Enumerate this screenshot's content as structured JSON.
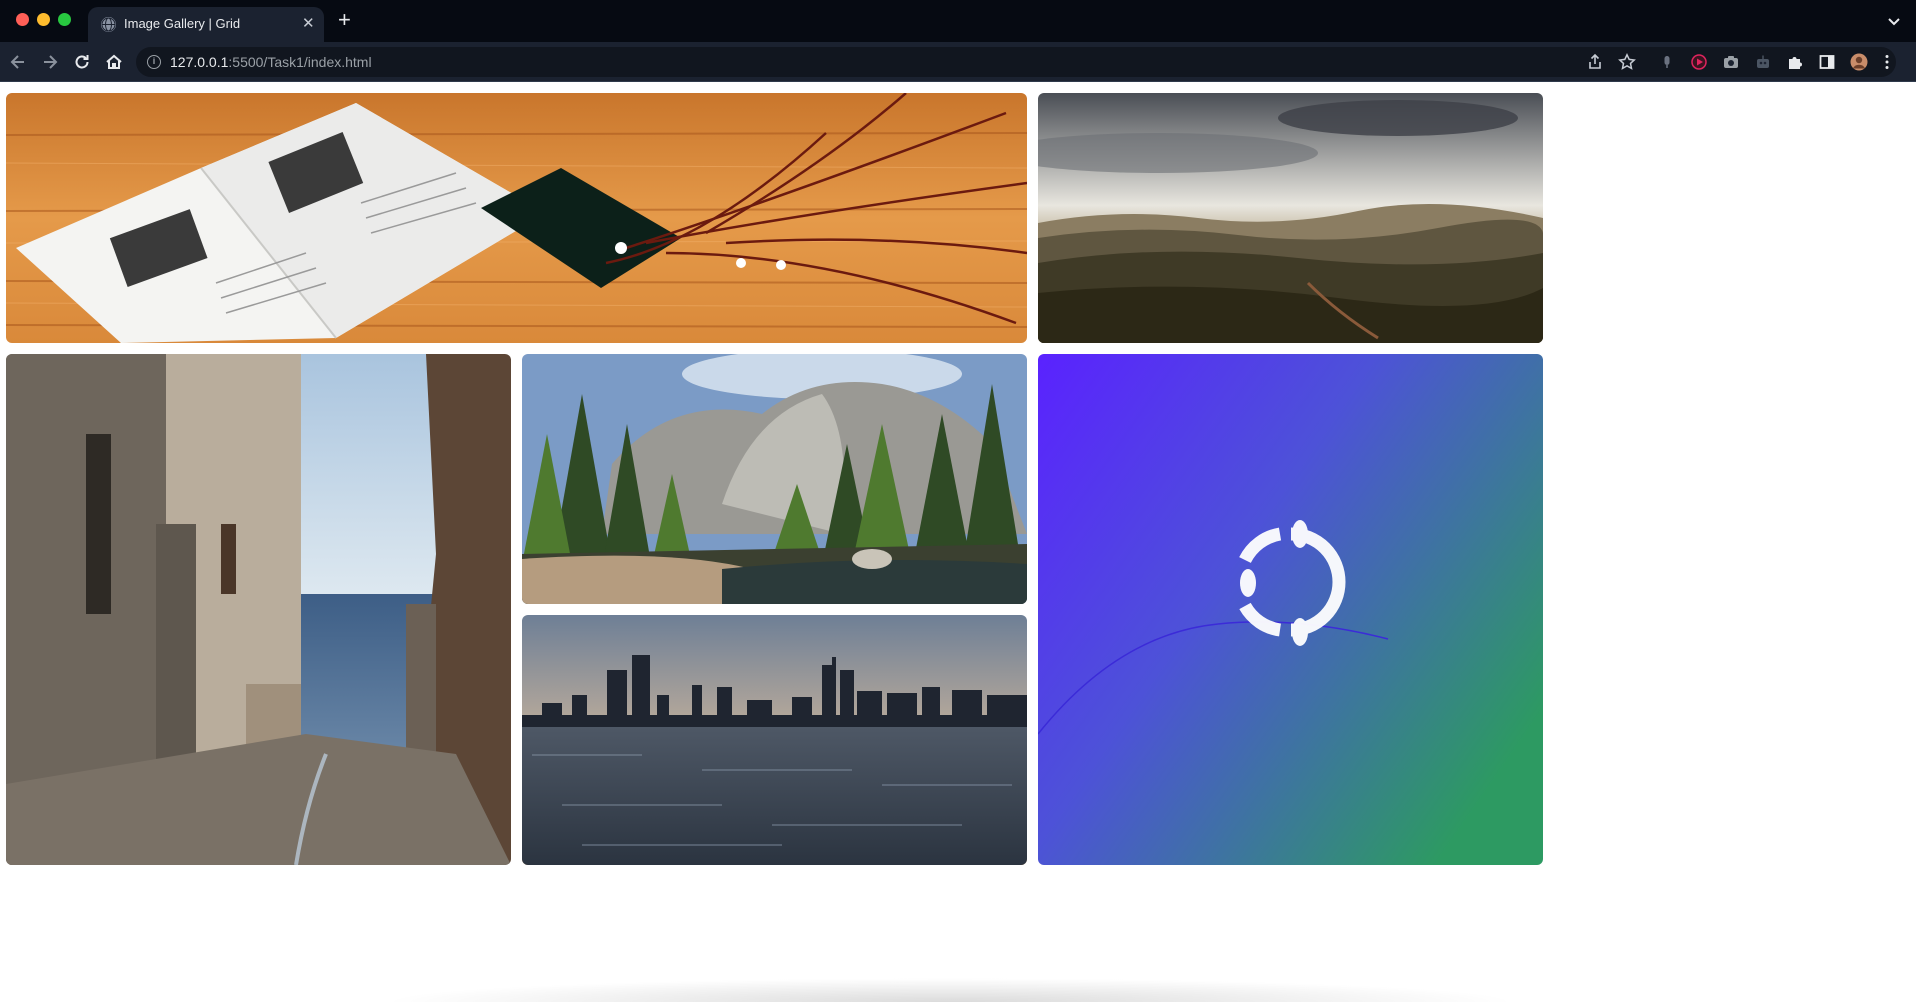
{
  "browser": {
    "tab_title": "Image Gallery | Grid",
    "tab_close": "✕",
    "new_tab": "+",
    "url_host": "127.0.0.1",
    "url_path": ":5500/Task1/index.html",
    "site_info": "i"
  },
  "gallery": {
    "images": [
      {
        "name": "open-magazine-on-wooden-table"
      },
      {
        "name": "hills-under-cloudy-sky"
      },
      {
        "name": "narrow-alley-to-sea"
      },
      {
        "name": "forest-and-granite-cliff"
      },
      {
        "name": "city-skyline-over-water"
      },
      {
        "name": "ubuntu-gradient-wallpaper"
      }
    ]
  },
  "colors": {
    "accent_violet": "#5a2bff",
    "accent_green": "#2f9e61",
    "wood": "#d98c3c"
  }
}
